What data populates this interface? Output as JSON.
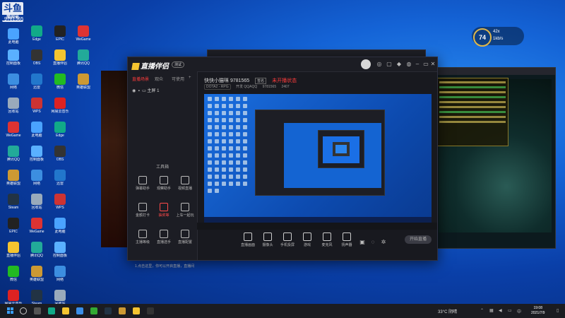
{
  "watermark": {
    "main": "斗鱼",
    "sub": "房间号"
  },
  "room_id": "9781565",
  "desktop_icons": [
    {
      "label": "此电脑",
      "color": "#4aa3ff"
    },
    {
      "label": "控制面板",
      "color": "#5ab0ff"
    },
    {
      "label": "网络",
      "color": "#3c8ee0"
    },
    {
      "label": "回收站",
      "color": "#9ab"
    },
    {
      "label": "WeGame",
      "color": "#d33"
    },
    {
      "label": "腾讯QQ",
      "color": "#2a9"
    },
    {
      "label": "英雄联盟",
      "color": "#c93"
    },
    {
      "label": "Steam",
      "color": "#234"
    },
    {
      "label": "EPIC",
      "color": "#222"
    },
    {
      "label": "直播伴侣",
      "color": "#f4c430"
    },
    {
      "label": "微信",
      "color": "#2b2"
    },
    {
      "label": "网易云音乐",
      "color": "#d22"
    },
    {
      "label": "Edge",
      "color": "#1a8"
    },
    {
      "label": "OBS",
      "color": "#333"
    },
    {
      "label": "迅雷",
      "color": "#27c"
    },
    {
      "label": "WPS",
      "color": "#c33"
    }
  ],
  "ring_widget": {
    "value": "74",
    "line1": "42x",
    "line2": "1kb/s"
  },
  "main_window": {
    "logo": "直播伴侣",
    "badge": "测试",
    "tabs": [
      "直播场景",
      "观众",
      "可使用"
    ],
    "scene_label": "主屏 1",
    "title": "快快小猫咪 9781565",
    "title_tag": "签名",
    "title_status": "未开播状态",
    "sub": [
      "DOTA2 - RPG",
      "开发 QQAQQ",
      "9781565",
      "2407"
    ],
    "tools_title": "工具箱",
    "tools": [
      {
        "label": "弹幕助手"
      },
      {
        "label": "观察助手"
      },
      {
        "label": "视频直播"
      },
      {
        "label": "金额打卡"
      },
      {
        "label": "抽奖等",
        "red": true
      },
      {
        "label": "上车一起玩"
      },
      {
        "label": "主播等级"
      },
      {
        "label": "直播选手"
      },
      {
        "label": "直播配置"
      }
    ],
    "hint": "1.点击这里，你可以开启直播，直播间会实时，获取你的直播状态；2.在本地录制；3.上一场播",
    "controls": [
      {
        "label": "直播画面"
      },
      {
        "label": "摄像头"
      },
      {
        "label": "手机投屏"
      },
      {
        "label": "游戏"
      },
      {
        "label": "麦克风"
      },
      {
        "label": "扬声器"
      }
    ],
    "go_live": "开始直播"
  },
  "taskbar": {
    "weather": "33°C 阴晴",
    "clock_time": "19:08",
    "clock_date": "2021/7/9",
    "tray_lang": "中"
  }
}
